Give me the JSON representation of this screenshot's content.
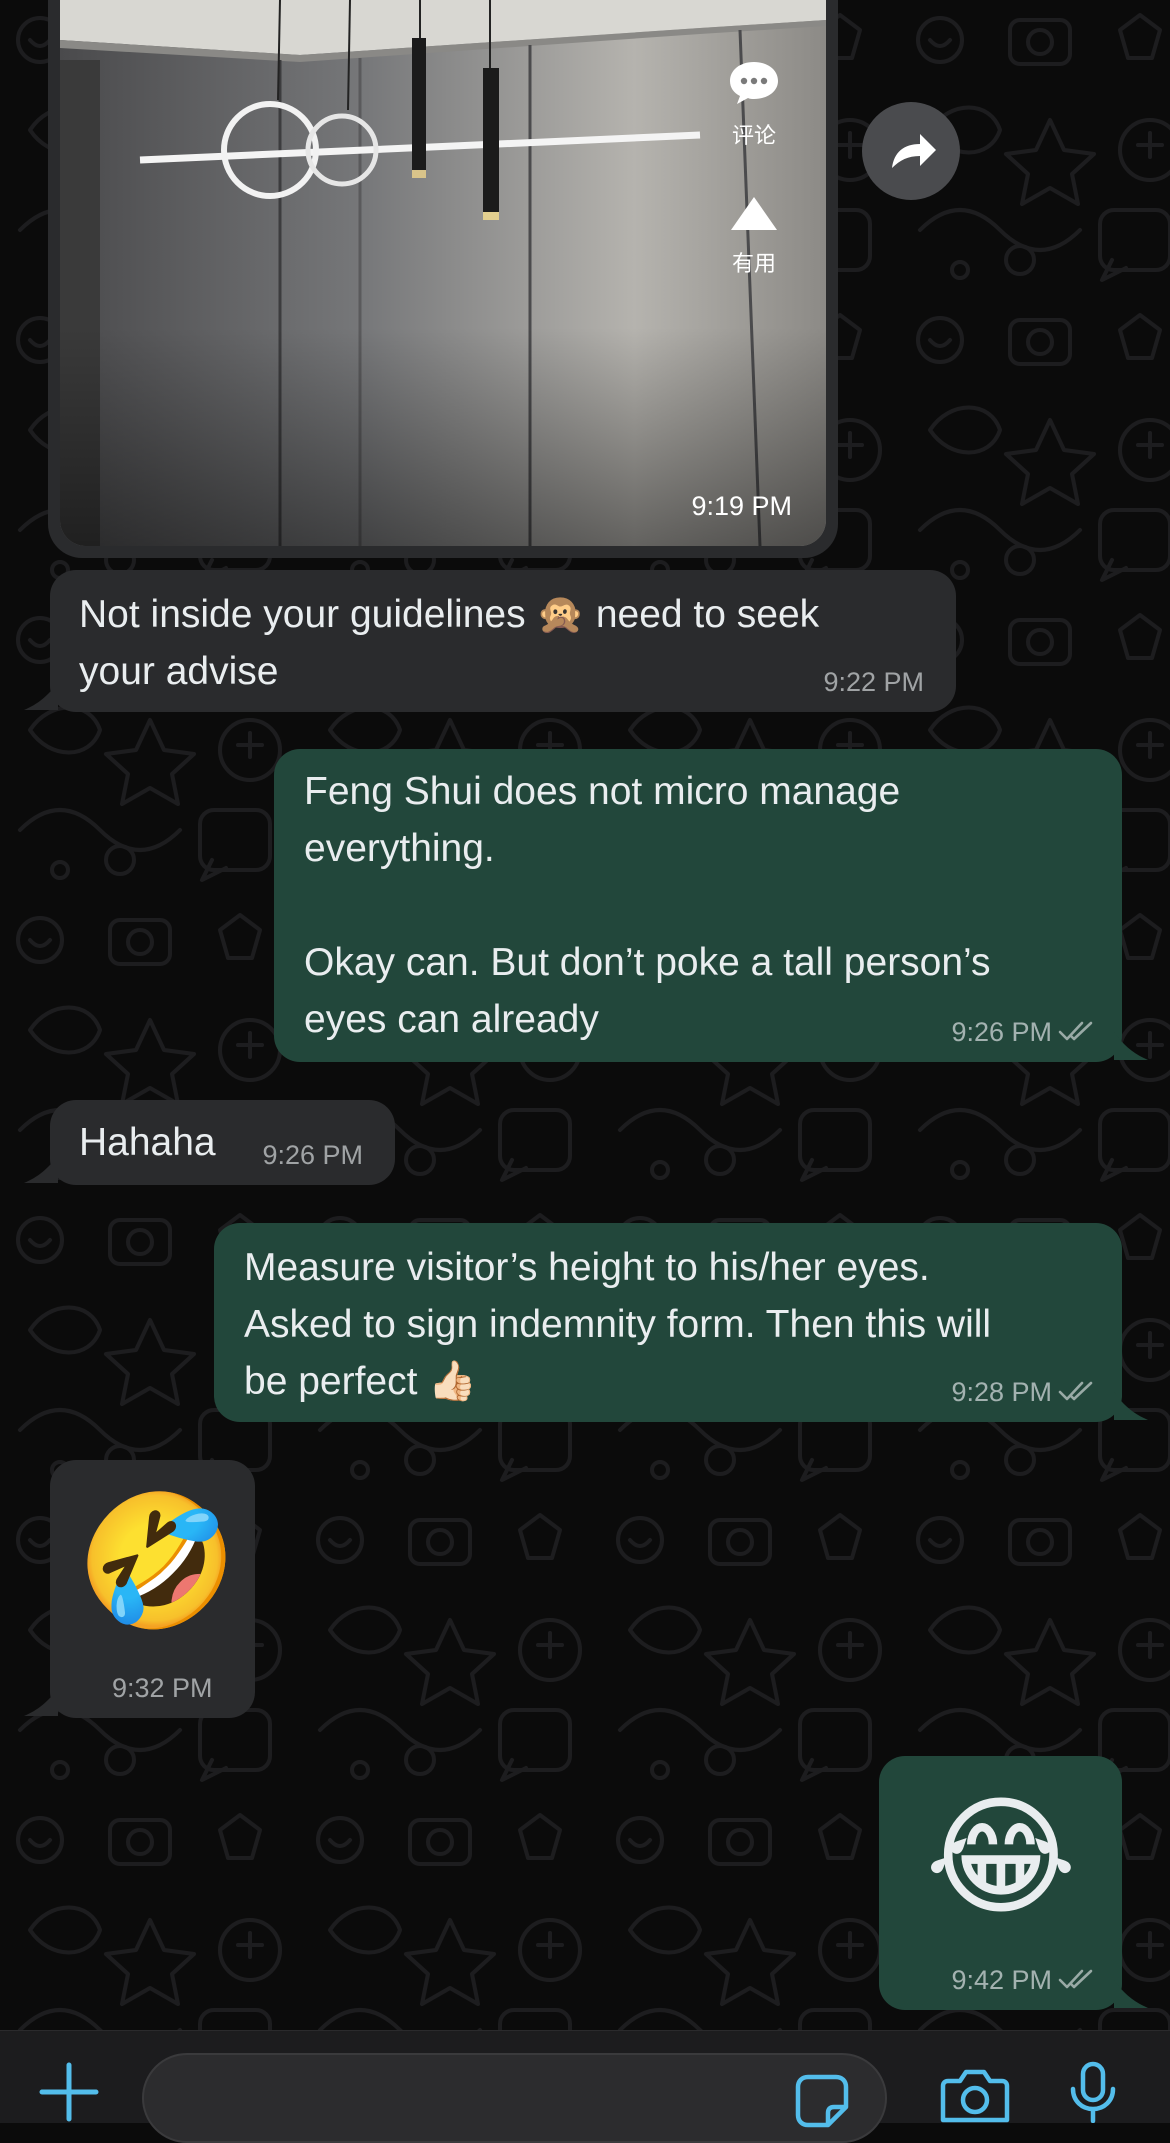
{
  "chat": {
    "image_message": {
      "time": "9:19 PM",
      "overlay_actions": [
        {
          "icon": "comment-bubble-icon",
          "label": "评论"
        },
        {
          "icon": "triangle-up-icon",
          "label": "有用"
        }
      ]
    },
    "messages": [
      {
        "direction": "incoming",
        "text": "Not inside your guidelines 🙊 need to seek\nyour advise",
        "time": "9:22 PM"
      },
      {
        "direction": "outgoing",
        "text": "Feng Shui does not micro manage\neverything.\n\nOkay can. But don’t poke a tall person’s\neyes can already",
        "time": "9:26 PM",
        "status": "read-double-check-icon"
      },
      {
        "direction": "incoming",
        "text": "Hahaha",
        "time": "9:26 PM"
      },
      {
        "direction": "outgoing",
        "text": "Measure visitor’s height to his/her eyes.\nAsked to sign indemnity form. Then this will\nbe perfect 👍🏻",
        "time": "9:28 PM",
        "status": "read-double-check-icon"
      },
      {
        "direction": "incoming",
        "emoji": "🤣",
        "time": "9:32 PM"
      },
      {
        "direction": "outgoing",
        "emoji": "😂",
        "time": "9:42 PM",
        "status": "read-double-check-icon"
      }
    ]
  },
  "input_bar": {
    "placeholder": "",
    "icons": [
      "plus-icon",
      "sticker-icon",
      "camera-icon",
      "microphone-icon"
    ]
  },
  "colors": {
    "background": "#0b0b0b",
    "incoming_bubble": "#2a2b2d",
    "outgoing_bubble": "#22473b",
    "accent": "#53bdeb"
  }
}
